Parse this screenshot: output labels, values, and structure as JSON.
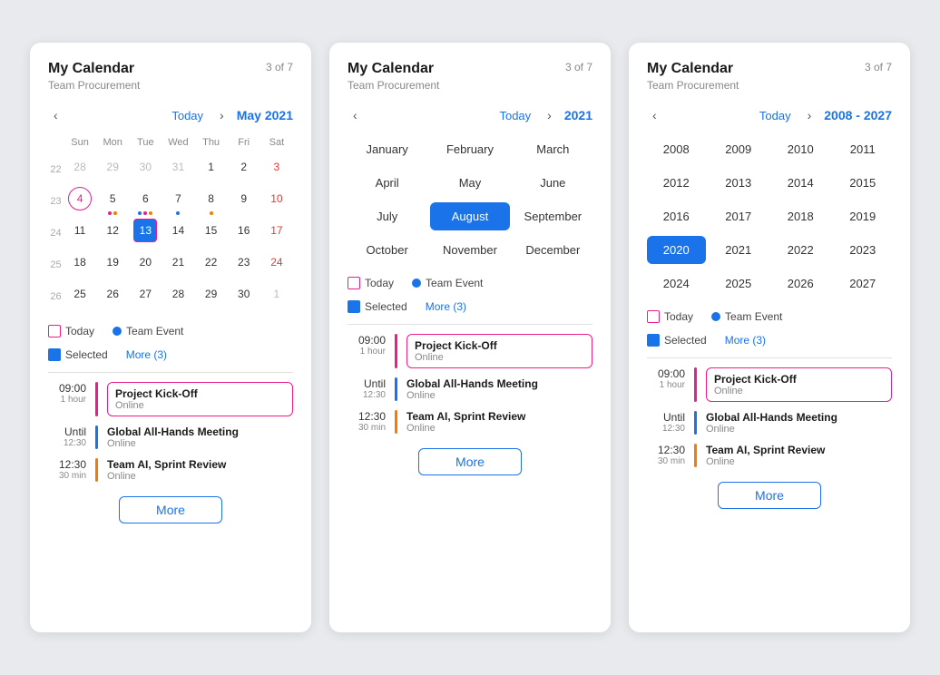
{
  "cards": [
    {
      "id": "card-monthly",
      "title": "My Calendar",
      "subtitle": "Team Procurement",
      "count": "3 of 7",
      "view": "monthly",
      "nav": {
        "today_label": "Today",
        "period_label": "May 2021"
      },
      "calendar": {
        "headers": [
          "Sun",
          "Mon",
          "Tue",
          "Wed",
          "Thu",
          "Fri",
          "Sat"
        ],
        "weeks": [
          {
            "week_num": "22",
            "days": [
              {
                "num": "28",
                "other": true
              },
              {
                "num": "29",
                "other": true
              },
              {
                "num": "30",
                "other": true
              },
              {
                "num": "31",
                "other": true
              },
              {
                "num": "1",
                "sat": false
              },
              {
                "num": "2",
                "sat": false
              },
              {
                "num": "3",
                "sat": true
              }
            ]
          },
          {
            "week_num": "23",
            "days": [
              {
                "num": "4",
                "today_style": true
              },
              {
                "num": "5",
                "dots": [
                  "#e91e8c",
                  "#f57c00"
                ]
              },
              {
                "num": "6",
                "dots": [
                  "#1a73e8",
                  "#e91e8c",
                  "#f57c00"
                ]
              },
              {
                "num": "7",
                "dots": [
                  "#1a73e8"
                ]
              },
              {
                "num": "8",
                "dots": [
                  "#f57c00"
                ]
              },
              {
                "num": "9"
              },
              {
                "num": "10",
                "sat": true
              }
            ]
          },
          {
            "week_num": "24",
            "days": [
              {
                "num": "11"
              },
              {
                "num": "12"
              },
              {
                "num": "13",
                "selected": true,
                "today_border": true
              },
              {
                "num": "14"
              },
              {
                "num": "15"
              },
              {
                "num": "16"
              },
              {
                "num": "17",
                "sat": true
              }
            ]
          },
          {
            "week_num": "25",
            "days": [
              {
                "num": "18"
              },
              {
                "num": "19"
              },
              {
                "num": "20"
              },
              {
                "num": "21"
              },
              {
                "num": "22"
              },
              {
                "num": "23"
              },
              {
                "num": "24",
                "sat": true
              }
            ]
          },
          {
            "week_num": "26",
            "days": [
              {
                "num": "25",
                "circle": true
              },
              {
                "num": "26"
              },
              {
                "num": "27"
              },
              {
                "num": "28"
              },
              {
                "num": "29"
              },
              {
                "num": "30"
              },
              {
                "num": "1",
                "other": true,
                "sat": true
              }
            ]
          }
        ]
      },
      "legend": {
        "today_label": "Today",
        "team_event_label": "Team Event",
        "selected_label": "Selected",
        "more_label": "More (3)"
      },
      "events": [
        {
          "time_main": "09:00",
          "time_sub": "1 hour",
          "bar_color": "#e91e8c",
          "title": "Project Kick-Off",
          "location": "Online",
          "bordered": true
        },
        {
          "time_main": "Until",
          "time_sub": "12:30",
          "bar_color": "#1a73e8",
          "title": "Global All-Hands Meeting",
          "location": "Online",
          "bordered": false
        },
        {
          "time_main": "12:30",
          "time_sub": "30 min",
          "bar_color": "#f57c00",
          "title": "Team AI, Sprint Review",
          "location": "Online",
          "bordered": false
        }
      ],
      "more_btn_label": "More"
    },
    {
      "id": "card-month-picker",
      "title": "My Calendar",
      "subtitle": "Team Procurement",
      "count": "3 of 7",
      "view": "month-picker",
      "nav": {
        "today_label": "Today",
        "period_label": "2021"
      },
      "months": [
        {
          "label": "January",
          "selected": false
        },
        {
          "label": "February",
          "selected": false
        },
        {
          "label": "March",
          "selected": false
        },
        {
          "label": "April",
          "selected": false
        },
        {
          "label": "May",
          "selected": false
        },
        {
          "label": "June",
          "selected": false
        },
        {
          "label": "July",
          "selected": false
        },
        {
          "label": "August",
          "selected": true
        },
        {
          "label": "September",
          "selected": false
        },
        {
          "label": "October",
          "selected": false
        },
        {
          "label": "November",
          "selected": false
        },
        {
          "label": "December",
          "selected": false
        }
      ],
      "legend": {
        "today_label": "Today",
        "team_event_label": "Team Event",
        "selected_label": "Selected",
        "more_label": "More (3)"
      },
      "events": [
        {
          "time_main": "09:00",
          "time_sub": "1 hour",
          "bar_color": "#e91e8c",
          "title": "Project Kick-Off",
          "location": "Online",
          "bordered": true
        },
        {
          "time_main": "Until",
          "time_sub": "12:30",
          "bar_color": "#1a73e8",
          "title": "Global All-Hands Meeting",
          "location": "Online",
          "bordered": false
        },
        {
          "time_main": "12:30",
          "time_sub": "30 min",
          "bar_color": "#f57c00",
          "title": "Team AI, Sprint Review",
          "location": "Online",
          "bordered": false
        }
      ],
      "more_btn_label": "More"
    },
    {
      "id": "card-year-picker",
      "title": "My Calendar",
      "subtitle": "Team Procurement",
      "count": "3 of 7",
      "view": "year-picker",
      "nav": {
        "today_label": "Today",
        "period_label": "2008 - 2027"
      },
      "years": [
        {
          "label": "2008",
          "selected": false
        },
        {
          "label": "2009",
          "selected": false
        },
        {
          "label": "2010",
          "selected": false
        },
        {
          "label": "2011",
          "selected": false
        },
        {
          "label": "2012",
          "selected": false
        },
        {
          "label": "2013",
          "selected": false
        },
        {
          "label": "2014",
          "selected": false
        },
        {
          "label": "2015",
          "selected": false
        },
        {
          "label": "2016",
          "selected": false
        },
        {
          "label": "2017",
          "selected": false
        },
        {
          "label": "2018",
          "selected": false
        },
        {
          "label": "2019",
          "selected": false
        },
        {
          "label": "2020",
          "selected": true
        },
        {
          "label": "2021",
          "selected": false
        },
        {
          "label": "2022",
          "selected": false
        },
        {
          "label": "2023",
          "selected": false
        },
        {
          "label": "2024",
          "selected": false
        },
        {
          "label": "2025",
          "selected": false
        },
        {
          "label": "2026",
          "selected": false
        },
        {
          "label": "2027",
          "selected": false
        }
      ],
      "legend": {
        "today_label": "Today",
        "team_event_label": "Team Event",
        "selected_label": "Selected",
        "more_label": "More (3)"
      },
      "events": [
        {
          "time_main": "09:00",
          "time_sub": "1 hour",
          "bar_color": "#e91e8c",
          "title": "Project Kick-Off",
          "location": "Online",
          "bordered": true
        },
        {
          "time_main": "Until",
          "time_sub": "12:30",
          "bar_color": "#1a73e8",
          "title": "Global All-Hands Meeting",
          "location": "Online",
          "bordered": false
        },
        {
          "time_main": "12:30",
          "time_sub": "30 min",
          "bar_color": "#f57c00",
          "title": "Team AI, Sprint Review",
          "location": "Online",
          "bordered": false
        }
      ],
      "more_btn_label": "More"
    }
  ]
}
